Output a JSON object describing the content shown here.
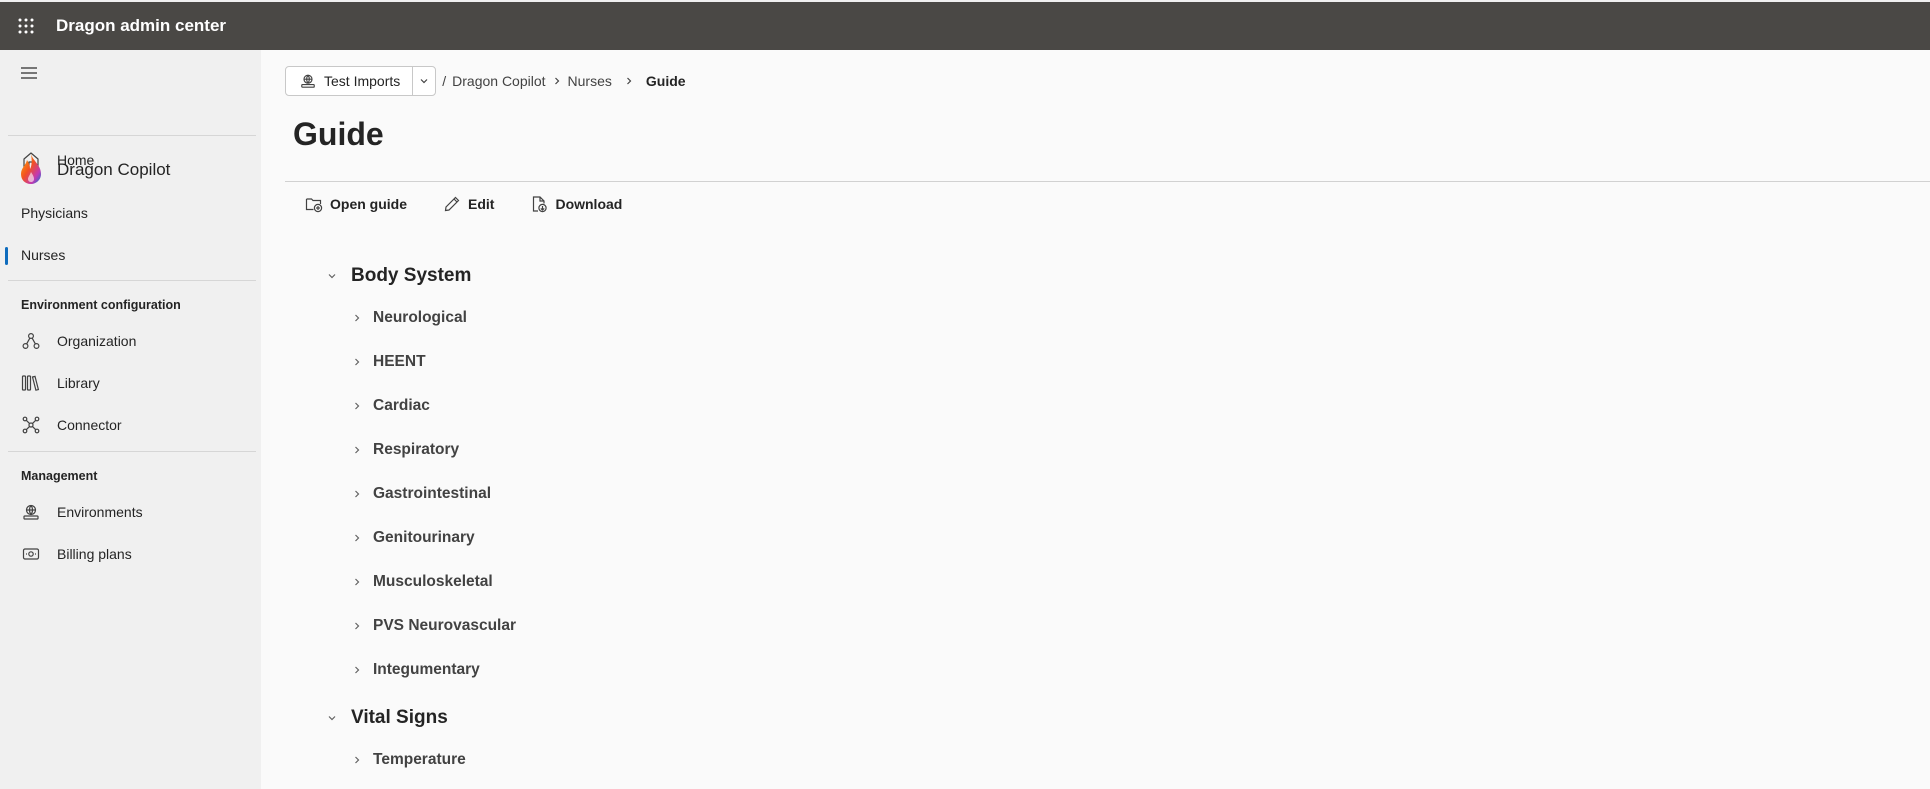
{
  "app": {
    "title": "Dragon admin center"
  },
  "sidebar": {
    "home_label": "Home",
    "product_label": "Dragon Copilot",
    "physicians_label": "Physicians",
    "nurses_label": "Nurses",
    "env_config_header": "Environment configuration",
    "organization_label": "Organization",
    "library_label": "Library",
    "connector_label": "Connector",
    "management_header": "Management",
    "environments_label": "Environments",
    "billing_label": "Billing plans"
  },
  "breadcrumb": {
    "environment": "Test Imports",
    "separator": "/",
    "items": [
      "Dragon Copilot",
      "Nurses",
      "Guide"
    ]
  },
  "page": {
    "title": "Guide"
  },
  "toolbar": {
    "open_label": "Open guide",
    "edit_label": "Edit",
    "download_label": "Download"
  },
  "tree": {
    "body_system": {
      "label": "Body System",
      "items": [
        "Neurological",
        "HEENT",
        "Cardiac",
        "Respiratory",
        "Gastrointestinal",
        "Genitourinary",
        "Musculoskeletal",
        "PVS Neurovascular",
        "Integumentary"
      ]
    },
    "vital_signs": {
      "label": "Vital Signs",
      "items": [
        "Temperature"
      ]
    }
  },
  "colors": {
    "topbar": "#4a4845",
    "accent": "#0f6cbd",
    "sidebar_bg": "#f0f0f0"
  }
}
